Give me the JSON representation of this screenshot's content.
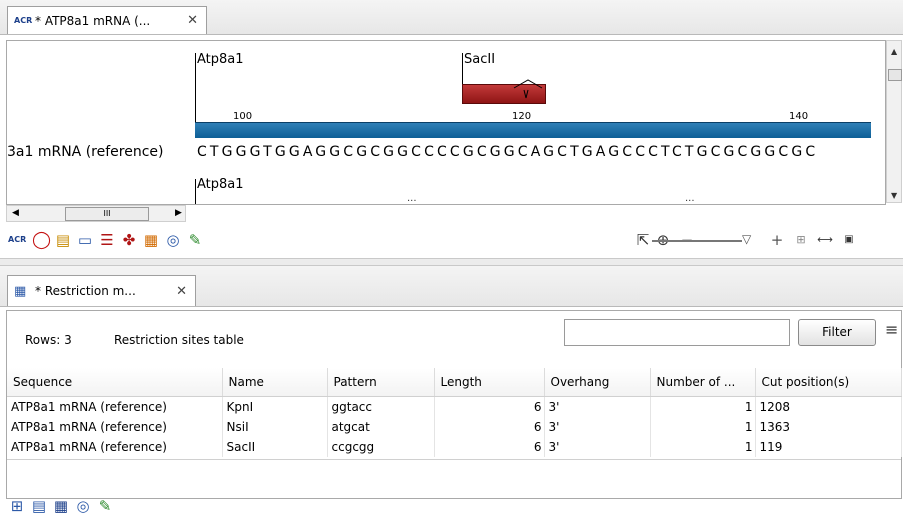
{
  "top_tab": {
    "icon": "ACR",
    "title": "* ATP8a1 mRNA (...",
    "close": "✕"
  },
  "sequence_view": {
    "features": [
      {
        "label": "Atp8a1"
      },
      {
        "label": "SacII"
      },
      {
        "label": "Atp8a1"
      }
    ],
    "ruler": [
      "100",
      "120",
      "140"
    ],
    "sequence_name": "3a1 mRNA (reference)",
    "sequence": "CTGGGTGGAGGCGCGGCCCCGCGGCAGCTGAGCCCTCTGCGCGGCGC",
    "dots": [
      "...",
      "...",
      "..."
    ],
    "hscroll_thumb": "III"
  },
  "bottom_tab": {
    "title": "* Restriction m...",
    "close": "✕"
  },
  "table_editor": {
    "rows_label": "Rows: 3",
    "table_label": "Restriction sites table",
    "filter_placeholder": "",
    "filter_button": "Filter",
    "columns": [
      "Sequence",
      "Name",
      "Pattern",
      "Length",
      "Overhang",
      "Number of ...",
      "Cut position(s)"
    ],
    "rows": [
      {
        "sequence": "ATP8a1 mRNA (reference)",
        "name": "KpnI",
        "pattern": "ggtacc",
        "length": "6",
        "overhang": "3'",
        "number": "1",
        "cut": "1208"
      },
      {
        "sequence": "ATP8a1 mRNA (reference)",
        "name": "NsiI",
        "pattern": "atgcat",
        "length": "6",
        "overhang": "3'",
        "number": "1",
        "cut": "1363"
      },
      {
        "sequence": "ATP8a1 mRNA (reference)",
        "name": "SacII",
        "pattern": "ccgcgg",
        "length": "6",
        "overhang": "3'",
        "number": "1",
        "cut": "119"
      }
    ]
  },
  "colors": {
    "track": "#1a6aa3",
    "restriction_site": "#a82222"
  }
}
